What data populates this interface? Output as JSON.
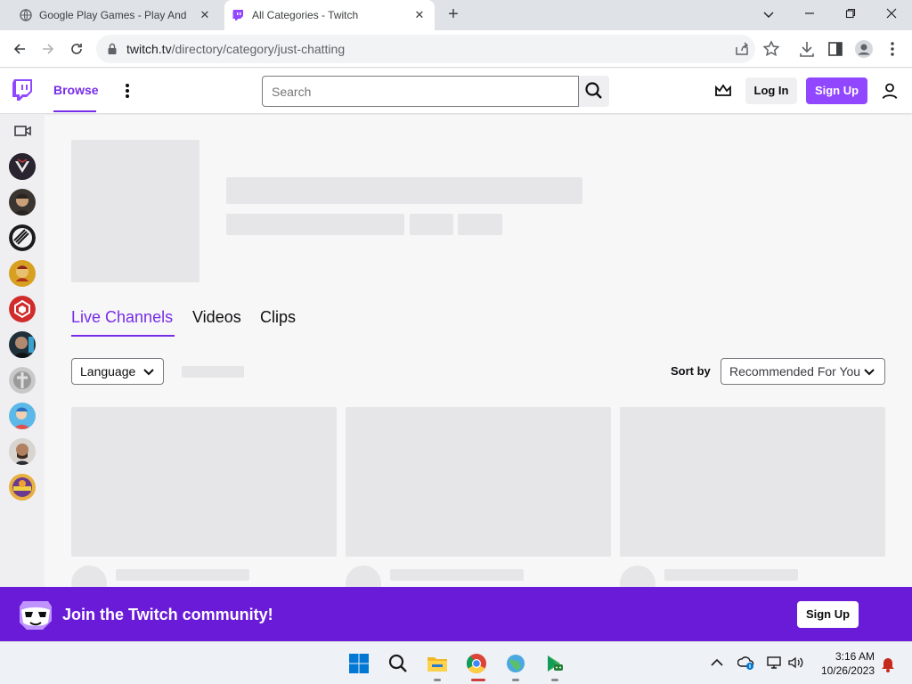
{
  "browser": {
    "tabs": [
      {
        "title": "Google Play Games - Play Andro",
        "active": false
      },
      {
        "title": "All Categories - Twitch",
        "active": true
      }
    ],
    "url_host": "twitch.tv",
    "url_path": "/directory/category/just-chatting"
  },
  "twitch": {
    "nav": {
      "browse": "Browse",
      "search_placeholder": "Search",
      "login": "Log In",
      "signup": "Sign Up"
    },
    "content_tabs": [
      "Live Channels",
      "Videos",
      "Clips"
    ],
    "active_tab": "Live Channels",
    "filters": {
      "language": "Language",
      "sort_label": "Sort by",
      "sort_value": "Recommended For You"
    },
    "banner": {
      "text": "Join the Twitch community!",
      "signup": "Sign Up"
    },
    "brand_color": "#9147ff",
    "accent_color": "#772ce8"
  },
  "taskbar": {
    "time": "3:16 AM",
    "date": "10/26/2023"
  }
}
